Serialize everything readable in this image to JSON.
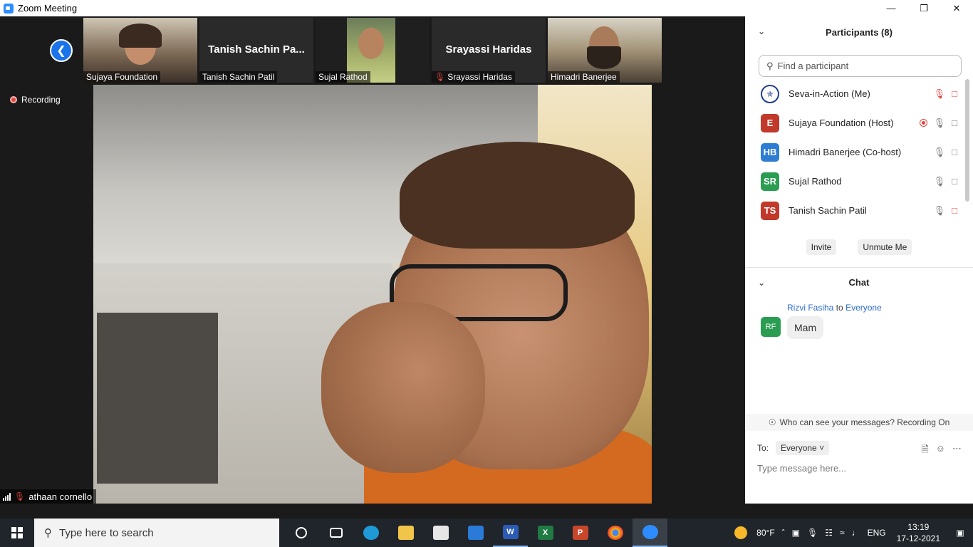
{
  "window": {
    "title": "Zoom Meeting",
    "controls": [
      "—",
      "❐",
      "✕"
    ]
  },
  "recording_label": "Recording",
  "thumbnails": [
    {
      "name": "Sujaya Foundation",
      "video": true,
      "muted": false
    },
    {
      "name": "Tanish Sachin Patil",
      "display_name": "Tanish Sachin Pa...",
      "video": false,
      "muted": false
    },
    {
      "name": "Sujal Rathod",
      "video": true,
      "muted": false
    },
    {
      "name": "Srayassi Haridas",
      "display_name": "Srayassi Haridas",
      "video": false,
      "muted": true
    },
    {
      "name": "Himadri Banerjee",
      "video": true,
      "muted": false
    }
  ],
  "main_video": {
    "name": "athaan cornello",
    "muted": true
  },
  "participants": {
    "header": "Participants (8)",
    "search_placeholder": "Find a participant",
    "list": [
      {
        "name": "Seva-in-Action (Me)",
        "initials": "",
        "color": "#1d3f8c",
        "recording": false,
        "mic_muted": true,
        "video_off": true
      },
      {
        "name": "Sujaya Foundation (Host)",
        "initials": "E",
        "color": "#c0392b",
        "recording": true,
        "mic_muted": false,
        "video_off": false
      },
      {
        "name": "Himadri Banerjee (Co-host)",
        "initials": "HB",
        "color": "#2d7dd2",
        "recording": false,
        "mic_muted": false,
        "video_off": false
      },
      {
        "name": "Sujal Rathod",
        "initials": "SR",
        "color": "#2a9d52",
        "recording": false,
        "mic_muted": false,
        "video_off": false
      },
      {
        "name": "Tanish Sachin Patil",
        "initials": "TS",
        "color": "#c0392b",
        "recording": false,
        "mic_muted": false,
        "video_off": true
      }
    ],
    "invite_label": "Invite",
    "unmute_label": "Unmute Me"
  },
  "chat": {
    "header": "Chat",
    "messages": [
      {
        "from": "Rizvi Fasiha",
        "to_word": "to",
        "to": "Everyone",
        "initials": "RF",
        "text": "Mam"
      }
    ],
    "notice": "Who can see your messages? Recording On",
    "to_label": "To:",
    "to_value": "Everyone",
    "input_placeholder": "Type message here..."
  },
  "taskbar": {
    "search_placeholder": "Type here to search",
    "weather": "80°F",
    "language": "ENG",
    "time": "13:19",
    "date": "17-12-2021"
  }
}
